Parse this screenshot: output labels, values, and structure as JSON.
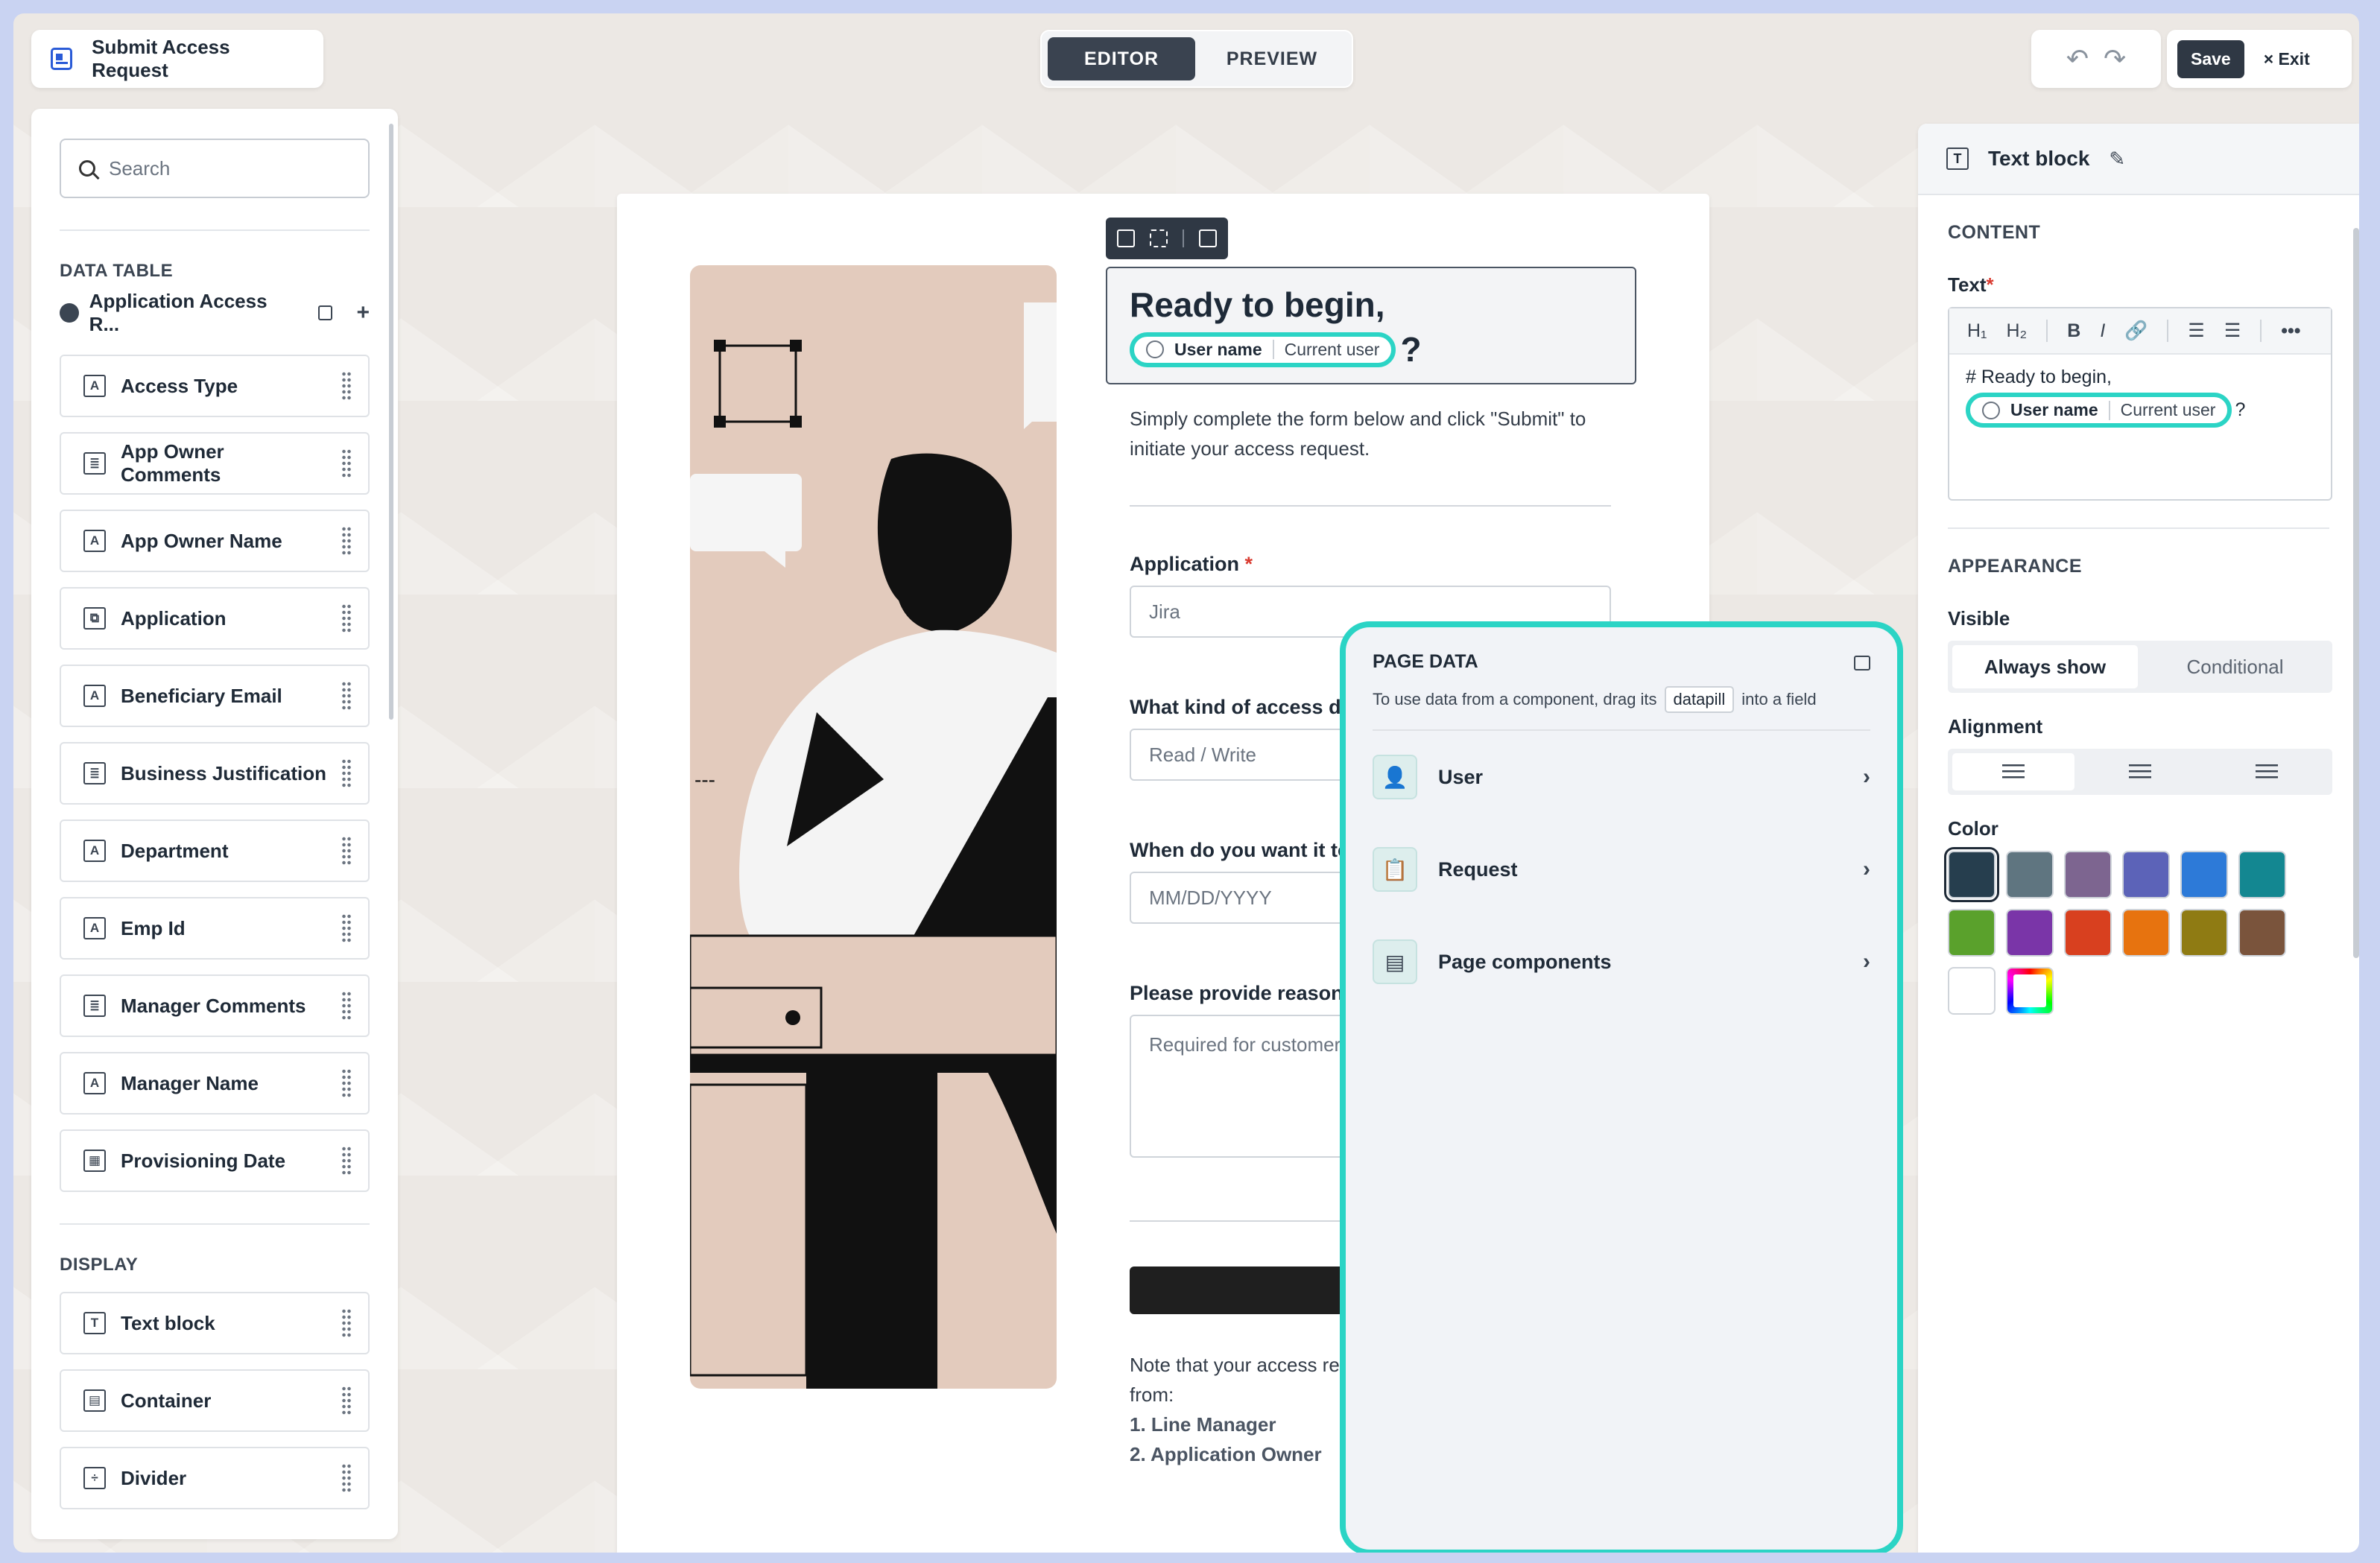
{
  "app": {
    "title": "Submit Access Request"
  },
  "mode": {
    "editor": "EDITOR",
    "preview": "PREVIEW"
  },
  "header": {
    "undo": "↶",
    "redo": "↷",
    "save": "Save",
    "exit": "× Exit"
  },
  "sidebar": {
    "search_placeholder": "Search",
    "data_table_title": "DATA TABLE",
    "data_source": "Application Access R...",
    "fields": [
      {
        "label": "Access Type",
        "icon": "text-field-icon"
      },
      {
        "label": "App Owner Comments",
        "icon": "textarea-field-icon"
      },
      {
        "label": "App Owner Name",
        "icon": "text-field-icon"
      },
      {
        "label": "Application",
        "icon": "reference-field-icon"
      },
      {
        "label": "Beneficiary Email",
        "icon": "text-field-icon"
      },
      {
        "label": "Business Justification",
        "icon": "textarea-field-icon"
      },
      {
        "label": "Department",
        "icon": "text-field-icon"
      },
      {
        "label": "Emp Id",
        "icon": "text-field-icon"
      },
      {
        "label": "Manager Comments",
        "icon": "textarea-field-icon"
      },
      {
        "label": "Manager Name",
        "icon": "text-field-icon"
      },
      {
        "label": "Provisioning Date",
        "icon": "calendar-icon"
      }
    ],
    "display_title": "DISPLAY",
    "display_items": [
      {
        "label": "Text block",
        "icon": "text-block-icon"
      },
      {
        "label": "Container",
        "icon": "container-icon"
      },
      {
        "label": "Divider",
        "icon": "divider-icon"
      }
    ]
  },
  "canvas": {
    "heading": "Ready to begin,",
    "pill": {
      "name": "User name",
      "source": "Current user"
    },
    "qmark": "?",
    "description": "Simply complete the form below and click \"Submit\" to initiate your access request.",
    "application_label": "Application",
    "application_value": "Jira",
    "access_label": "What kind of access do y",
    "access_placeholder": "Read / Write",
    "when_label": "When do you want it to",
    "date_placeholder": "MM/DD/YYYY",
    "reason_label": "Please provide reason fo",
    "reason_placeholder": "Required for customer management",
    "note_line1": "Note that your access re",
    "note_line2": "from:",
    "note_line3": "1. Line Manager",
    "note_line4": "2. Application Owner"
  },
  "page_data": {
    "title": "PAGE DATA",
    "subtitle_before": "To use data from a component, drag its",
    "subtitle_pill": "datapill",
    "subtitle_after": "into a field",
    "items": [
      {
        "label": "User",
        "icon": "user-icon"
      },
      {
        "label": "Request",
        "icon": "request-icon"
      },
      {
        "label": "Page components",
        "icon": "page-components-icon"
      }
    ]
  },
  "props": {
    "title": "Text block",
    "content_title": "CONTENT",
    "text_label": "Text",
    "rte_content": "# Ready to begin,",
    "appearance_title": "APPEARANCE",
    "visible_label": "Visible",
    "visible_options": [
      "Always show",
      "Conditional"
    ],
    "alignment_label": "Alignment",
    "color_label": "Color",
    "colors": [
      "#263e4e",
      "#5f7580",
      "#7d6590",
      "#5c63b8",
      "#2d7ad8",
      "#138791",
      "#5aa12c",
      "#7a35a8",
      "#d8401f",
      "#e7730f",
      "#8f7b13",
      "#7a543c",
      "#ffffff"
    ]
  }
}
